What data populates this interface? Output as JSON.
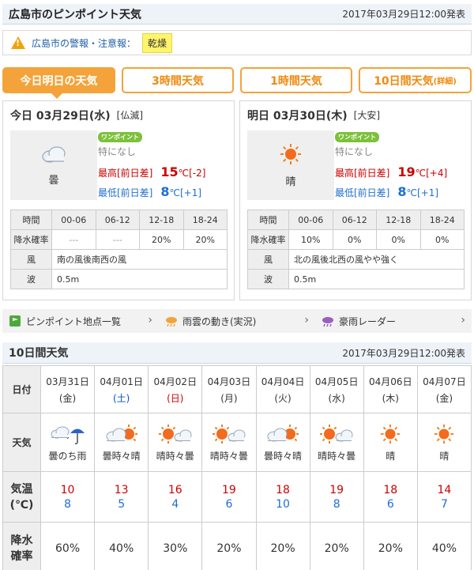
{
  "header": {
    "title": "広島市のピンポイント天気",
    "timestamp": "2017年03月29日12:00発表"
  },
  "warning": {
    "text": "広島市の警報・注意報：",
    "badge": "乾燥"
  },
  "tabs": [
    {
      "label": "今日明日の天気",
      "active": true
    },
    {
      "label": "3時間天気"
    },
    {
      "label": "1時間天気"
    },
    {
      "label": "10日間天気",
      "suffix": "(詳細)"
    }
  ],
  "days": [
    {
      "title": "今日 03月29日(水)",
      "rokuyo": "[仏滅]",
      "weather": "曇",
      "weather_icon": "cloud-icon",
      "onepoint": "ワンポイント",
      "note": "特になし",
      "high_label": "最高[前日差]",
      "high": "15",
      "high_diff": "[-2]",
      "low_label": "最低[前日差]",
      "low": "8",
      "low_diff": "[+1]",
      "unit": "℃",
      "rows": {
        "time_label": "時間",
        "times": [
          "00-06",
          "06-12",
          "12-18",
          "18-24"
        ],
        "pop_label": "降水確率",
        "pop": [
          "---",
          "---",
          "20%",
          "20%"
        ],
        "wind_label": "風",
        "wind": "南の風後南西の風",
        "wave_label": "波",
        "wave": "0.5m"
      }
    },
    {
      "title": "明日 03月30日(木)",
      "rokuyo": "[大安]",
      "weather": "晴",
      "weather_icon": "sun-icon",
      "onepoint": "ワンポイント",
      "note": "特になし",
      "high_label": "最高[前日差]",
      "high": "19",
      "high_diff": "[+4]",
      "low_label": "最低[前日差]",
      "low": "8",
      "low_diff": "[+1]",
      "unit": "℃",
      "rows": {
        "time_label": "時間",
        "times": [
          "00-06",
          "06-12",
          "12-18",
          "18-24"
        ],
        "pop_label": "降水確率",
        "pop": [
          "10%",
          "0%",
          "0%",
          "0%"
        ],
        "wind_label": "風",
        "wind": "北の風後北西の風やや強く",
        "wave_label": "波",
        "wave": "0.5m"
      }
    }
  ],
  "links": [
    {
      "label": "ピンポイント地点一覧",
      "icon": "pinpoint-icon"
    },
    {
      "label": "雨雲の動き(実況)",
      "icon": "rain-cloud-icon"
    },
    {
      "label": "豪雨レーダー",
      "icon": "radar-icon"
    }
  ],
  "ten_day": {
    "title": "10日間天気",
    "timestamp": "2017年03月29日12:00発表",
    "row_labels": {
      "date": "日付",
      "weather": "天気",
      "temp": "気温\n(℃)",
      "pop": "降水\n確率"
    },
    "days": [
      {
        "date": "03月31日",
        "dow": "(金)",
        "dow_class": "",
        "weather": "曇のち雨",
        "icon": "cloud-then-rain-icon",
        "high": "10",
        "low": "8",
        "pop": "60%"
      },
      {
        "date": "04月01日",
        "dow": "(土)",
        "dow_class": "sat",
        "weather": "曇時々晴",
        "icon": "cloud-sun-icon",
        "high": "13",
        "low": "5",
        "pop": "40%"
      },
      {
        "date": "04月02日",
        "dow": "(日)",
        "dow_class": "hol",
        "weather": "晴時々曇",
        "icon": "sun-cloud-icon",
        "high": "16",
        "low": "4",
        "pop": "30%"
      },
      {
        "date": "04月03日",
        "dow": "(月)",
        "dow_class": "",
        "weather": "晴時々曇",
        "icon": "sun-cloud-icon",
        "high": "19",
        "low": "6",
        "pop": "20%"
      },
      {
        "date": "04月04日",
        "dow": "(火)",
        "dow_class": "",
        "weather": "曇時々晴",
        "icon": "cloud-sun-icon",
        "high": "18",
        "low": "10",
        "pop": "20%"
      },
      {
        "date": "04月05日",
        "dow": "(水)",
        "dow_class": "",
        "weather": "晴時々曇",
        "icon": "sun-cloud-icon",
        "high": "19",
        "low": "8",
        "pop": "20%"
      },
      {
        "date": "04月06日",
        "dow": "(木)",
        "dow_class": "",
        "weather": "晴",
        "icon": "sun-icon",
        "high": "18",
        "low": "6",
        "pop": "20%"
      },
      {
        "date": "04月07日",
        "dow": "(金)",
        "dow_class": "",
        "weather": "晴",
        "icon": "sun-icon",
        "high": "14",
        "low": "7",
        "pop": "40%"
      }
    ]
  }
}
